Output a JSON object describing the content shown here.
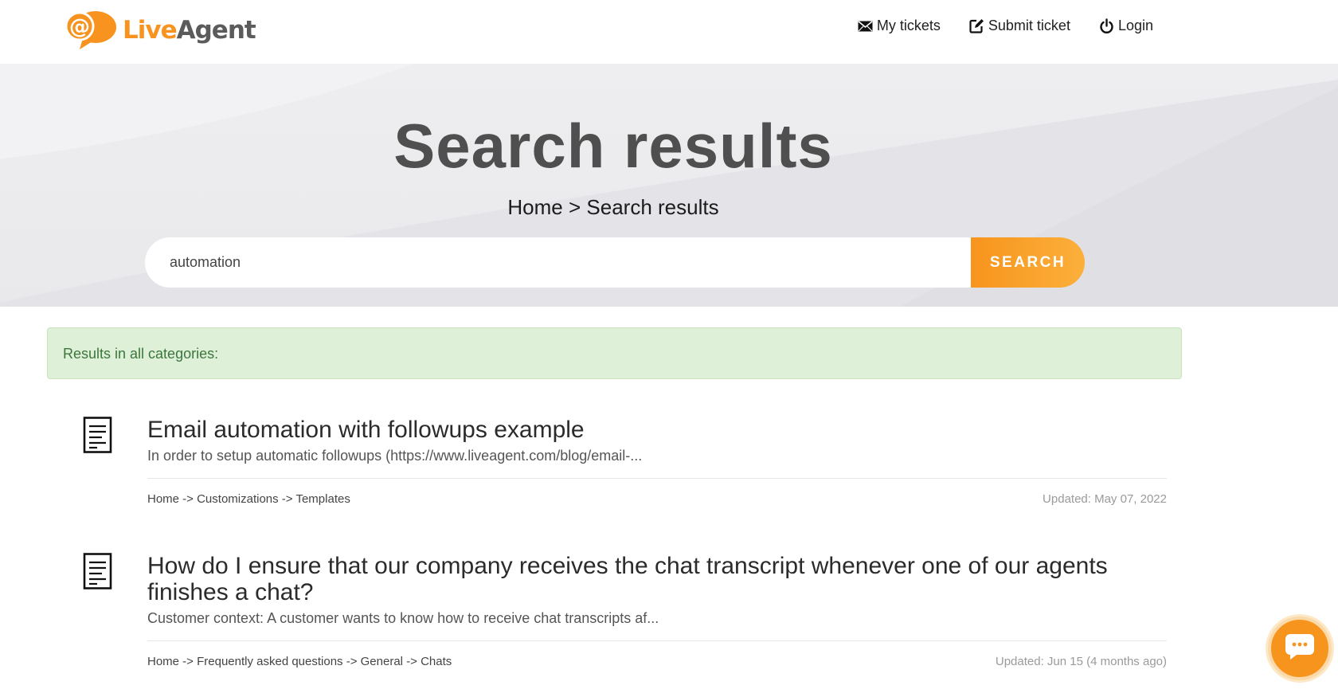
{
  "header": {
    "logo_text_live": "Live",
    "logo_text_agent": "Agent",
    "nav": [
      {
        "label": "My tickets",
        "icon": "envelope-icon"
      },
      {
        "label": "Submit ticket",
        "icon": "edit-icon"
      },
      {
        "label": "Login",
        "icon": "power-icon"
      }
    ]
  },
  "hero": {
    "title": "Search results",
    "breadcrumb": {
      "home": "Home",
      "separator": " > ",
      "current": "Search results"
    },
    "search": {
      "value": "automation",
      "button_label": "SEARCH"
    }
  },
  "notice": "Results in all categories:",
  "results": [
    {
      "title": "Email automation with followups example",
      "excerpt": "In order to setup automatic followups (https://www.liveagent.com/blog/email-...",
      "path": "Home -> Customizations -> Templates",
      "updated": "Updated: May 07, 2022"
    },
    {
      "title": "How do I ensure that our company receives the chat transcript whenever one of our agents finishes a chat?",
      "excerpt": "Customer context: A customer wants to know how to receive chat transcripts af...",
      "path": "Home -> Frequently asked questions -> General -> Chats",
      "updated": "Updated: Jun 15 (4 months ago)"
    }
  ],
  "colors": {
    "accent": "#f7941d",
    "notice_bg": "#dff0d8",
    "notice_text": "#3c763d"
  }
}
